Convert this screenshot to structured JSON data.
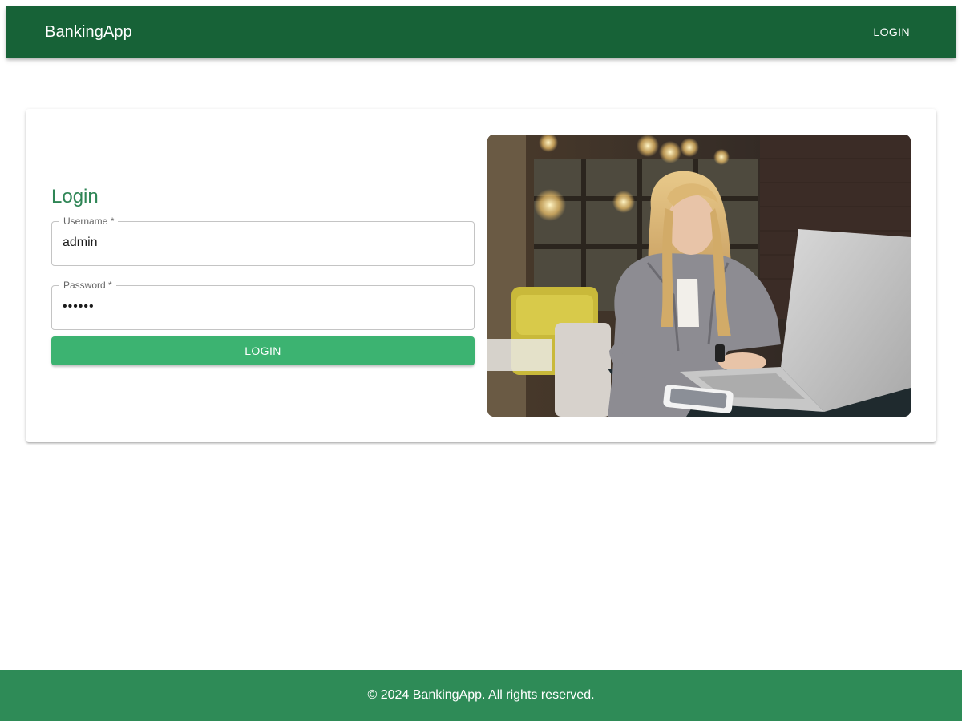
{
  "header": {
    "brand": "BankingApp",
    "nav_login": "LOGIN",
    "color": "#176237"
  },
  "login_form": {
    "title": "Login",
    "username_label": "Username *",
    "username_value": "admin",
    "password_label": "Password *",
    "password_value": "••••••",
    "submit_label": "LOGIN",
    "accent": "#2e8555",
    "button_color": "#3cb371"
  },
  "hero_image": {
    "icon": "woman-with-laptop-photo"
  },
  "footer": {
    "text": "© 2024 BankingApp. All rights reserved.",
    "color": "#2e8b57"
  }
}
